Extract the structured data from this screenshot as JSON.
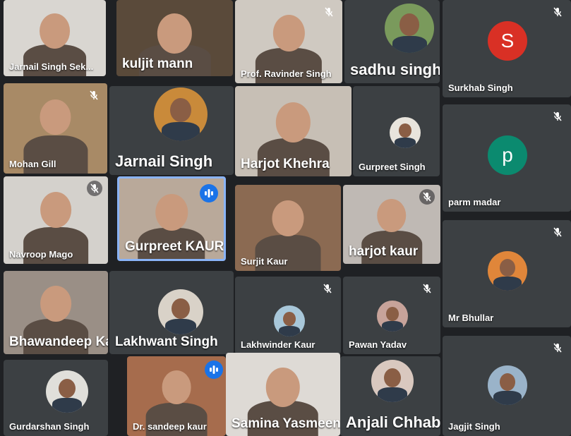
{
  "meeting": {
    "participants": [
      {
        "name": "Jarnail Singh Sek...",
        "muted": false,
        "avatar": "video"
      },
      {
        "name": "kuljit mann",
        "muted": false,
        "avatar": "video"
      },
      {
        "name": "Prof. Ravinder Singh",
        "muted": true,
        "avatar": "video"
      },
      {
        "name": "sadhu singh",
        "muted": false,
        "avatar": "photo"
      },
      {
        "name": "Surkhab Singh",
        "muted": true,
        "avatar": "letter",
        "letter": "S",
        "color": "#d93025"
      },
      {
        "name": "Mohan Gill",
        "muted": true,
        "avatar": "video"
      },
      {
        "name": "Jarnail Singh",
        "muted": false,
        "avatar": "photo"
      },
      {
        "name": "Harjot Khehra",
        "muted": false,
        "avatar": "video"
      },
      {
        "name": "Gurpreet Singh",
        "muted": false,
        "avatar": "photo"
      },
      {
        "name": "parm madar",
        "muted": true,
        "avatar": "letter",
        "letter": "p",
        "color": "#0b8a6f"
      },
      {
        "name": "Navroop Mago",
        "muted": true,
        "avatar": "video"
      },
      {
        "name": "Gurpreet KAUR",
        "muted": false,
        "speaking": true,
        "avatar": "video"
      },
      {
        "name": "Surjit Kaur",
        "muted": false,
        "avatar": "video"
      },
      {
        "name": "harjot kaur",
        "muted": true,
        "avatar": "video"
      },
      {
        "name": "Mr Bhullar",
        "muted": true,
        "avatar": "photo"
      },
      {
        "name": "Bhawandeep Kaur",
        "muted": false,
        "avatar": "video"
      },
      {
        "name": "Lakhwant Singh",
        "muted": false,
        "avatar": "photo"
      },
      {
        "name": "Lakhwinder Kaur",
        "muted": true,
        "avatar": "photo"
      },
      {
        "name": "Pawan Yadav",
        "muted": true,
        "avatar": "photo"
      },
      {
        "name": "Jagjit Singh",
        "muted": true,
        "avatar": "photo"
      },
      {
        "name": "Gurdarshan Singh",
        "muted": false,
        "avatar": "photo"
      },
      {
        "name": "Dr. sandeep kaur",
        "muted": false,
        "speaking": true,
        "avatar": "video"
      },
      {
        "name": "Samina Yasmeen",
        "muted": false,
        "avatar": "video"
      },
      {
        "name": "Anjali Chhabra",
        "muted": false,
        "avatar": "photo"
      }
    ]
  },
  "colors": {
    "background": "#1f2124",
    "tile": "#3c4043",
    "speaking_accent": "#1a73e8",
    "active_border": "#8ab4f8"
  },
  "icons": {
    "muted": "mic-off-icon",
    "speaking": "audio-bars-icon"
  }
}
